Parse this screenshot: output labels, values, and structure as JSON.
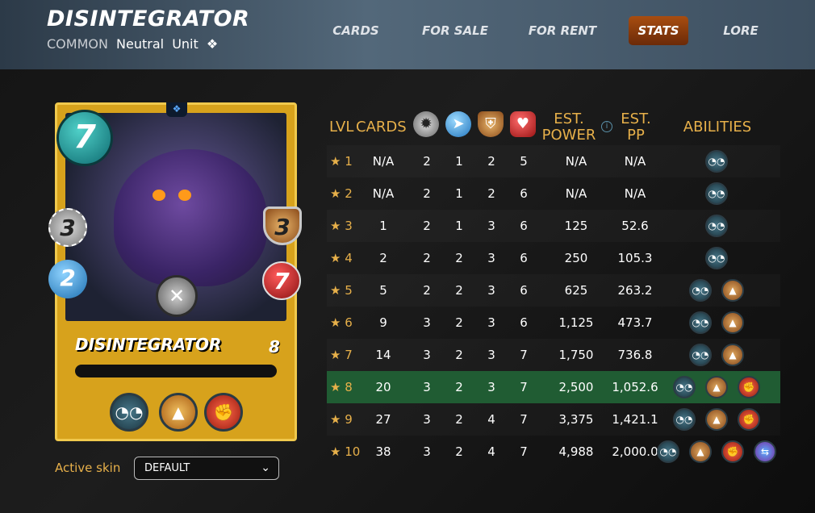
{
  "header": {
    "title": "DISINTEGRATOR",
    "rarity": "COMMON",
    "element": "Neutral",
    "type": "Unit",
    "type_icon": "diamond-icon"
  },
  "nav": {
    "tabs": [
      {
        "label": "CARDS",
        "active": false
      },
      {
        "label": "FOR SALE",
        "active": false
      },
      {
        "label": "FOR RENT",
        "active": false
      },
      {
        "label": "STATS",
        "active": true
      },
      {
        "label": "LORE",
        "active": false
      }
    ]
  },
  "card": {
    "name": "DISINTEGRATOR",
    "level": "8",
    "mana": "7",
    "melee": "3",
    "speed": "2",
    "armor": "3",
    "health": "7",
    "attack_type_icon": "crossed-swords-icon",
    "abilities": [
      "sneak-ability-icon",
      "demoralize-ability-icon",
      "punch-ability-icon"
    ]
  },
  "skin": {
    "label": "Active skin",
    "value": "DEFAULT"
  },
  "table": {
    "headers": {
      "lvl": "LVL",
      "cards": "CARDS",
      "melee_icon": "melee-attack-icon",
      "speed_icon": "speed-icon",
      "armor_icon": "armor-icon",
      "health_icon": "health-icon",
      "est_power_1": "EST.",
      "est_power_2": "POWER",
      "est_pp_1": "EST.",
      "est_pp_2": "PP",
      "abilities": "ABILITIES"
    },
    "rows": [
      {
        "lvl": "★ 1",
        "cards": "N/A",
        "melee": "2",
        "speed": "1",
        "armor": "2",
        "health": "5",
        "power": "N/A",
        "pp": "N/A",
        "abilities": 1
      },
      {
        "lvl": "★ 2",
        "cards": "N/A",
        "melee": "2",
        "speed": "1",
        "armor": "2",
        "health": "6",
        "power": "N/A",
        "pp": "N/A",
        "abilities": 1
      },
      {
        "lvl": "★ 3",
        "cards": "1",
        "melee": "2",
        "speed": "1",
        "armor": "3",
        "health": "6",
        "power": "125",
        "pp": "52.6",
        "abilities": 1
      },
      {
        "lvl": "★ 4",
        "cards": "2",
        "melee": "2",
        "speed": "2",
        "armor": "3",
        "health": "6",
        "power": "250",
        "pp": "105.3",
        "abilities": 1
      },
      {
        "lvl": "★ 5",
        "cards": "5",
        "melee": "2",
        "speed": "2",
        "armor": "3",
        "health": "6",
        "power": "625",
        "pp": "263.2",
        "abilities": 2
      },
      {
        "lvl": "★ 6",
        "cards": "9",
        "melee": "3",
        "speed": "2",
        "armor": "3",
        "health": "6",
        "power": "1,125",
        "pp": "473.7",
        "abilities": 2
      },
      {
        "lvl": "★ 7",
        "cards": "14",
        "melee": "3",
        "speed": "2",
        "armor": "3",
        "health": "7",
        "power": "1,750",
        "pp": "736.8",
        "abilities": 2
      },
      {
        "lvl": "★ 8",
        "cards": "20",
        "melee": "3",
        "speed": "2",
        "armor": "3",
        "health": "7",
        "power": "2,500",
        "pp": "1,052.6",
        "abilities": 3
      },
      {
        "lvl": "★ 9",
        "cards": "27",
        "melee": "3",
        "speed": "2",
        "armor": "4",
        "health": "7",
        "power": "3,375",
        "pp": "1,421.1",
        "abilities": 3
      },
      {
        "lvl": "★ 10",
        "cards": "38",
        "melee": "3",
        "speed": "2",
        "armor": "4",
        "health": "7",
        "power": "4,988",
        "pp": "2,000.0",
        "abilities": 4
      }
    ],
    "highlight_level": 8
  },
  "colors": {
    "accent": "#e7b04a",
    "active_tab": "#a84d10",
    "highlight_row": "#205c33"
  }
}
